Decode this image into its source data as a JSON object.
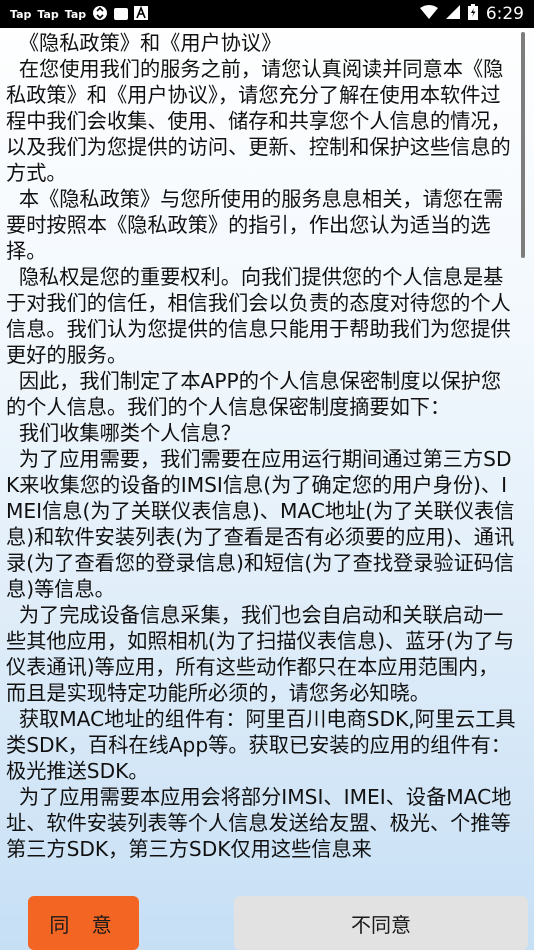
{
  "status_bar": {
    "apps": [
      "Tap",
      "Tap",
      "Tap"
    ],
    "time": "6:29",
    "battery_icon": "battery-icon",
    "wifi_icon": "wifi-icon",
    "signal_icon": "signal-icon"
  },
  "policy": {
    "paragraphs": [
      "  《隐私政策》和《用户协议》",
      "  在您使用我们的服务之前，请您认真阅读并同意本《隐私政策》和《用户协议》，请您充分了解在使用本软件过程中我们会收集、使用、储存和共享您个人信息的情况，以及我们为您提供的访问、更新、控制和保护这些信息的方式。",
      "  本《隐私政策》与您所使用的服务息息相关，请您在需要时按照本《隐私政策》的指引，作出您认为适当的选择。",
      "  隐私权是您的重要权利。向我们提供您的个人信息是基于对我们的信任，相信我们会以负责的态度对待您的个人信息。我们认为您提供的信息只能用于帮助我们为您提供更好的服务。",
      "  因此，我们制定了本APP的个人信息保密制度以保护您的个人信息。我们的个人信息保密制度摘要如下：",
      "  我们收集哪类个人信息？",
      "  为了应用需要，我们需要在应用运行期间通过第三方SDK来收集您的设备的IMSI信息(为了确定您的用户身份)、IMEI信息(为了关联仪表信息)、MAC地址(为了关联仪表信息)和软件安装列表(为了查看是否有必须要的应用)、通讯录(为了查看您的登录信息)和短信(为了查找登录验证码信息)等信息。",
      "  为了完成设备信息采集，我们也会自启动和关联启动一些其他应用，如照相机(为了扫描仪表信息)、蓝牙(为了与仪表通讯)等应用，所有这些动作都只在本应用范围内，而且是实现特定功能所必须的，请您务必知晓。",
      "  获取MAC地址的组件有：阿里百川电商SDK,阿里云工具类SDK，百科在线App等。获取已安装的应用的组件有：极光推送SDK。",
      "  为了应用需要本应用会将部分IMSI、IMEI、设备MAC地址、软件安装列表等个人信息发送给友盟、极光、个推等第三方SDK，第三方SDK仅用这些信息来"
    ]
  },
  "buttons": {
    "agree": "同 意",
    "disagree": "不同意"
  },
  "colors": {
    "agree_bg": "#f26522",
    "disagree_bg": "#e2e2e2",
    "status_bar_bg": "#000000"
  }
}
